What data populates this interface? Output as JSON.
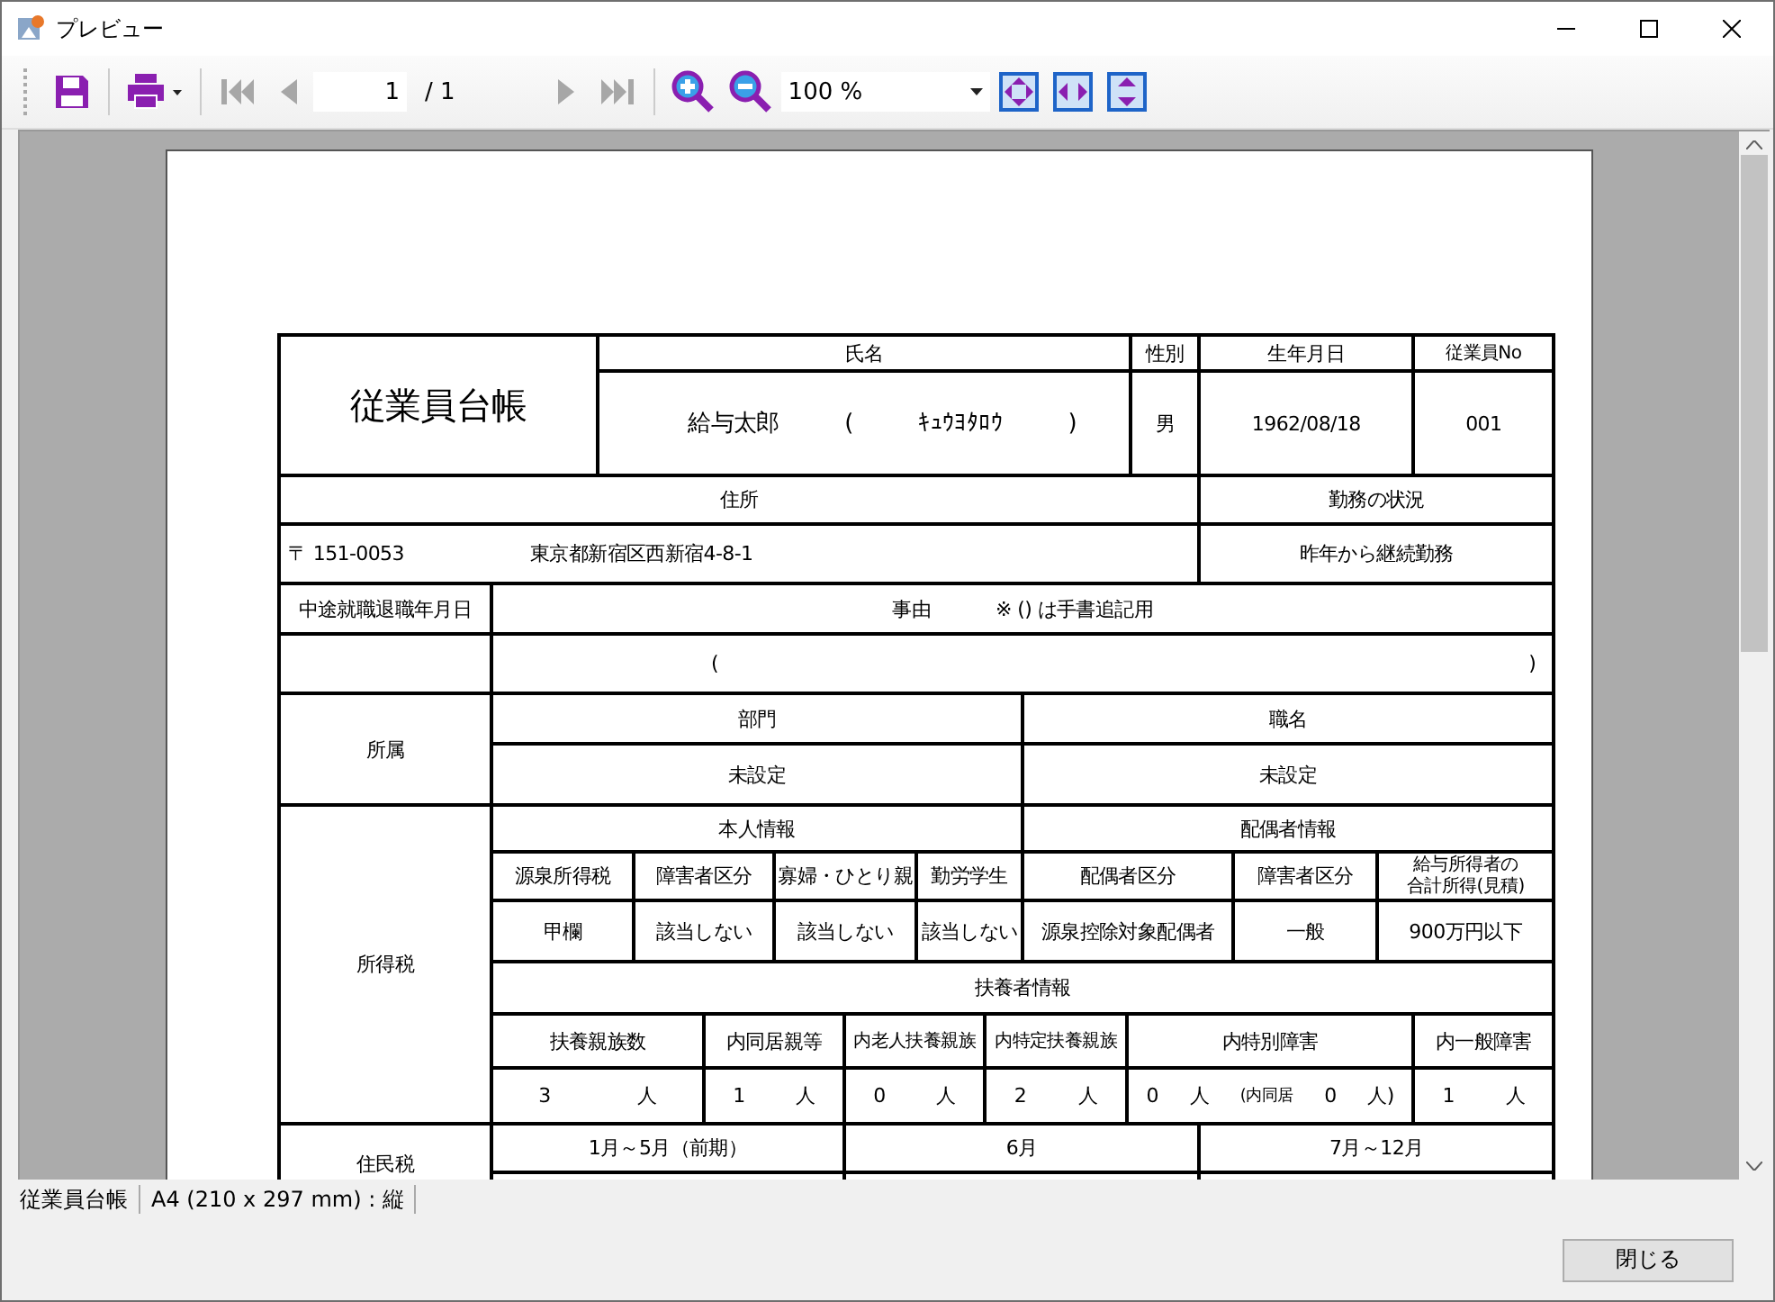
{
  "window": {
    "title": "プレビュー"
  },
  "toolbar": {
    "items": [
      {
        "kind": "save"
      },
      {
        "kind": "print"
      },
      {
        "kind": "first",
        "disabled": true
      },
      {
        "kind": "prev",
        "disabled": true
      },
      {
        "kind": "page",
        "value": "1",
        "total": "/ 1"
      },
      {
        "kind": "next",
        "disabled": true
      },
      {
        "kind": "last",
        "disabled": true
      },
      {
        "kind": "zoom-in"
      },
      {
        "kind": "zoom-out"
      },
      {
        "kind": "zoom",
        "value": "100 %"
      },
      {
        "kind": "fit-page"
      },
      {
        "kind": "fit-width"
      },
      {
        "kind": "fit-height"
      }
    ]
  },
  "form": {
    "title": "従業員台帳",
    "sections": [
      "所属",
      "所得税",
      "住民税"
    ],
    "lines": [
      [
        "氏名",
        "性別",
        "生年月日",
        "従業員No"
      ],
      [
        [
          "給与太郎",
          "(",
          "ｷｭｳﾖﾀﾛｳ",
          ")"
        ],
        "男",
        "1962/08/18",
        "001"
      ],
      [
        "住所",
        "勤務の状況"
      ],
      [
        [
          "〒 151-0053",
          "東京都新宿区西新宿4-8-1"
        ],
        "昨年から継続勤務"
      ],
      [
        "中途就職退職年月日",
        [
          "事由",
          "※ () は手書追記用"
        ]
      ],
      [
        [
          "(",
          ")"
        ]
      ],
      [
        "部門",
        "職名"
      ],
      [
        "未設定",
        "未設定"
      ],
      [
        "本人情報",
        "配偶者情報"
      ],
      [
        "源泉所得税",
        "障害者区分",
        "寡婦・ひとり親",
        "勤労学生",
        "配偶者区分",
        "障害者区分",
        [
          "給与所得者の",
          "合計所得(見積)"
        ]
      ],
      [
        "甲欄",
        "該当しない",
        "該当しない",
        "該当しない",
        "源泉控除対象配偶者",
        "一般",
        "900万円以下"
      ],
      [
        "扶養者情報"
      ],
      [
        "扶養親族数",
        "内同居親等",
        "内老人扶養親族",
        "内特定扶養親族",
        "内特別障害",
        "内一般障害"
      ],
      [
        [
          "3",
          "人"
        ],
        [
          "1",
          "人"
        ],
        [
          "0",
          "人"
        ],
        [
          "2",
          "人"
        ],
        [
          "0",
          "人",
          "(内同居",
          "0",
          "人)"
        ],
        [
          "1",
          "人"
        ]
      ],
      [
        "1月～5月（前期）",
        "6月",
        "7月～12月"
      ]
    ]
  },
  "status_bar": {
    "items": [
      "従業員台帳",
      "A4 (210 x 297 mm) : 縦"
    ]
  },
  "buttons": [
    "閉じる"
  ]
}
